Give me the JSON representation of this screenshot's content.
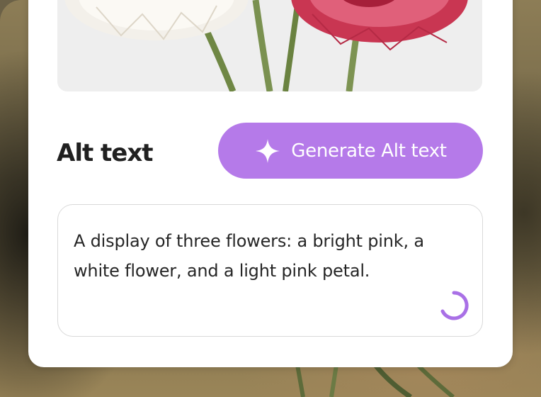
{
  "alt_text_section": {
    "heading": "Alt text",
    "generate_button_label": "Generate Alt text",
    "description": "A display of three flowers: a bright pink, a white flower, and a light pink petal."
  },
  "icons": {
    "generate": "sparkle-icon",
    "status": "loading-spinner-icon"
  },
  "colors": {
    "accent": "#b57ae9",
    "card_background": "#ffffff",
    "text_primary": "#202020",
    "input_border": "#d9d9d9"
  }
}
